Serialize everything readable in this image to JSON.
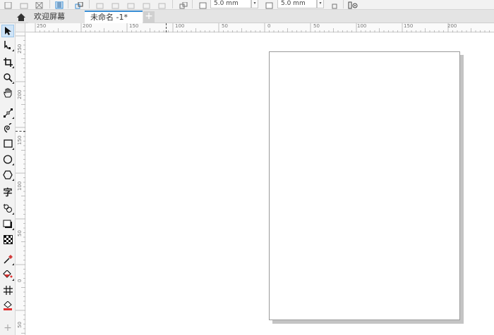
{
  "propbar": {
    "nudge_h": "5.0 mm",
    "nudge_v": "5.0 mm"
  },
  "tabs": {
    "welcome": "欢迎屏幕",
    "document": "未命名 -1*",
    "add": "+"
  },
  "ruler": {
    "h_labels": [
      "250",
      "200",
      "150",
      "100",
      "50",
      "0",
      "50",
      "100",
      "150",
      "200"
    ],
    "v_labels": [
      "250",
      "200",
      "150",
      "100",
      "50",
      "0",
      "50"
    ]
  },
  "toolbox": {
    "text_tool_glyph": "字"
  },
  "colors": {
    "accent": "#3a8fd6",
    "active_tool_bg": "#cfe4f7",
    "page_shadow": "#c4c4c4"
  }
}
